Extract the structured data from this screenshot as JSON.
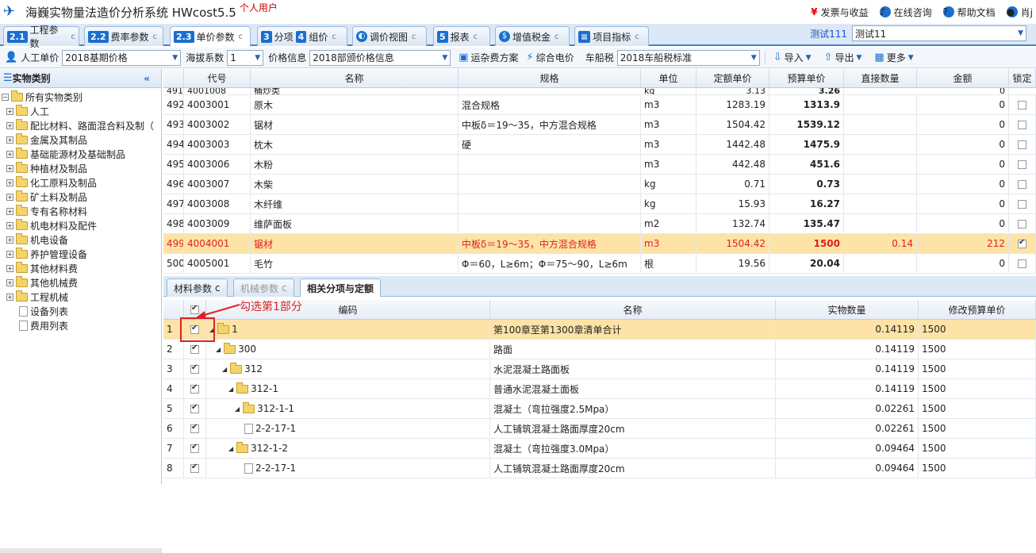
{
  "app": {
    "title": "海巍实物量法造价分析系统 HWcost5.5",
    "user_tag": "个人用户"
  },
  "top_right": {
    "invoice": "发票与收益",
    "consult": "在线咨询",
    "help": "帮助文档",
    "user": "肖j"
  },
  "tabs": [
    {
      "num": "2.1",
      "label": "工程参数"
    },
    {
      "num": "2.2",
      "label": "费率参数"
    },
    {
      "num": "2.3",
      "label": "单价参数"
    },
    {
      "num": "3",
      "label": "分项"
    },
    {
      "num": "4",
      "label": "组价"
    },
    {
      "num": "",
      "label": "调价视图"
    },
    {
      "num": "5",
      "label": "报表"
    },
    {
      "num": "",
      "label": "增值税金"
    },
    {
      "num": "",
      "label": "项目指标"
    }
  ],
  "project": {
    "label": "测试111",
    "value": "测试11"
  },
  "toolbar": {
    "labor_label": "人工单价",
    "labor_value": "2018基期价格",
    "alt_label": "海拔系数",
    "alt_value": "1",
    "price_label": "价格信息",
    "price_value": "2018部颁价格信息",
    "freight": "运杂费方案",
    "power": "综合电价",
    "tax_label": "车船税",
    "tax_value": "2018车船税标准",
    "import": "导入",
    "export": "导出",
    "more": "更多"
  },
  "left": {
    "title": "实物类别",
    "root": "所有实物类别",
    "items": [
      "人工",
      "配比材料、路面混合料及制（",
      "金属及其制品",
      "基础能源材及基础制品",
      "种植材及制品",
      "化工原料及制品",
      "矿土料及制品",
      "专有名称材料",
      "机电材料及配件",
      "机电设备",
      "养护管理设备",
      "其他材料费",
      "其他机械费",
      "工程机械"
    ],
    "docs": [
      "设备列表",
      "费用列表"
    ]
  },
  "grid1": {
    "headers": [
      "",
      "代号",
      "名称",
      "规格",
      "单位",
      "定额单价",
      "预算单价",
      "直接数量",
      "金额",
      "锁定"
    ],
    "partial": {
      "no": "491",
      "code": "4001008",
      "name": "桶炒类",
      "unit": "kg",
      "quota": "3.13",
      "budget": "3.26",
      "amount": "0"
    },
    "rows": [
      {
        "no": "492",
        "code": "4003001",
        "name": "原木",
        "spec": "混合规格",
        "unit": "m3",
        "quota": "1283.19",
        "budget": "1313.9",
        "qty": "",
        "amount": "0"
      },
      {
        "no": "493",
        "code": "4003002",
        "name": "锯材",
        "spec": "中板δ＝19～35，中方混合规格",
        "unit": "m3",
        "quota": "1504.42",
        "budget": "1539.12",
        "qty": "",
        "amount": "0"
      },
      {
        "no": "494",
        "code": "4003003",
        "name": "枕木",
        "spec": "硬",
        "unit": "m3",
        "quota": "1442.48",
        "budget": "1475.9",
        "qty": "",
        "amount": "0"
      },
      {
        "no": "495",
        "code": "4003006",
        "name": "木粉",
        "spec": "",
        "unit": "m3",
        "quota": "442.48",
        "budget": "451.6",
        "qty": "",
        "amount": "0"
      },
      {
        "no": "496",
        "code": "4003007",
        "name": "木柴",
        "spec": "",
        "unit": "kg",
        "quota": "0.71",
        "budget": "0.73",
        "qty": "",
        "amount": "0"
      },
      {
        "no": "497",
        "code": "4003008",
        "name": "木纤维",
        "spec": "",
        "unit": "kg",
        "quota": "15.93",
        "budget": "16.27",
        "qty": "",
        "amount": "0"
      },
      {
        "no": "498",
        "code": "4003009",
        "name": "维萨面板",
        "spec": "",
        "unit": "m2",
        "quota": "132.74",
        "budget": "135.47",
        "qty": "",
        "amount": "0"
      },
      {
        "no": "499",
        "code": "4004001",
        "name": "锯材",
        "spec": "中板δ＝19～35，中方混合规格",
        "unit": "m3",
        "quota": "1504.42",
        "budget": "1500",
        "qty": "0.14",
        "amount": "212"
      },
      {
        "no": "500",
        "code": "4005001",
        "name": "毛竹",
        "spec": "Φ＝60，L≥6m；Φ＝75～90，L≥6m",
        "unit": "根",
        "quota": "19.56",
        "budget": "20.04",
        "qty": "",
        "amount": "0"
      }
    ]
  },
  "subtabs": [
    "材料参数",
    "机械参数",
    "相关分项与定额"
  ],
  "grid2": {
    "headers": [
      "",
      "",
      "编码",
      "名称",
      "实物数量",
      "修改预算单价"
    ],
    "rows": [
      {
        "no": "1",
        "code": "1",
        "name": "第100章至第1300章清单合计",
        "qty": "0.14119",
        "price": "1500"
      },
      {
        "no": "2",
        "code": "300",
        "name": "路面",
        "qty": "0.14119",
        "price": "1500"
      },
      {
        "no": "3",
        "code": "312",
        "name": "水泥混凝土路面板",
        "qty": "0.14119",
        "price": "1500"
      },
      {
        "no": "4",
        "code": "312-1",
        "name": "普通水泥混凝土面板",
        "qty": "0.14119",
        "price": "1500"
      },
      {
        "no": "5",
        "code": "312-1-1",
        "name": "混凝土（弯拉强度2.5Mpa）",
        "qty": "0.02261",
        "price": "1500"
      },
      {
        "no": "6",
        "code": "2-2-17-1",
        "name": "人工铺筑混凝土路面厚度20cm",
        "qty": "0.02261",
        "price": "1500"
      },
      {
        "no": "7",
        "code": "312-1-2",
        "name": "混凝土（弯拉强度3.0Mpa）",
        "qty": "0.09464",
        "price": "1500"
      },
      {
        "no": "8",
        "code": "2-2-17-1",
        "name": "人工铺筑混凝土路面厚度20cm",
        "qty": "0.09464",
        "price": "1500"
      }
    ]
  },
  "annotation": "勾选第1部分",
  "colors": {
    "accent": "#1a6fd0",
    "selected_row": "#fde3a7",
    "annotation": "#e02020"
  }
}
